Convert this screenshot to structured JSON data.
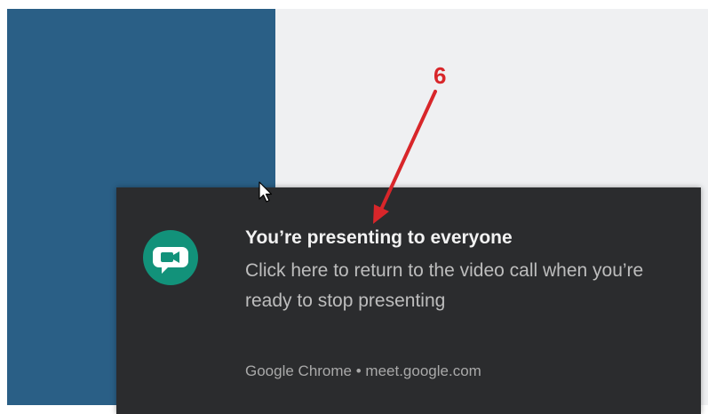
{
  "notification": {
    "title": "You’re presenting to everyone",
    "body": "Click here to return to the video call when you’re ready to stop presenting",
    "source": "Google Chrome • meet.google.com",
    "icon": "google-meet-icon"
  },
  "annotation": {
    "label": "6",
    "color": "#d8262a"
  },
  "colors": {
    "left_panel": "#2a5f86",
    "right_panel": "#eff0f2",
    "toast_background": "#2b2c2e",
    "meet_icon_green": "#12927a"
  }
}
